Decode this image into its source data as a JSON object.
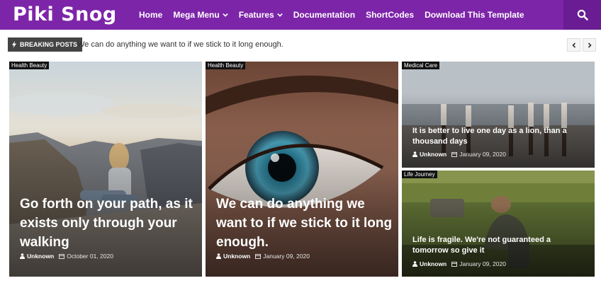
{
  "header": {
    "logo_text": "Piki Snog",
    "nav": [
      {
        "label": "Home",
        "has_dropdown": false
      },
      {
        "label": "Mega Menu",
        "has_dropdown": true
      },
      {
        "label": "Features",
        "has_dropdown": true
      },
      {
        "label": "Documentation",
        "has_dropdown": false
      },
      {
        "label": "ShortCodes",
        "has_dropdown": false
      },
      {
        "label": "Download This Template",
        "has_dropdown": false
      }
    ],
    "search_icon": "search-icon",
    "bg_color": "#7d25a9"
  },
  "ticker": {
    "label": "BREAKING POSTS",
    "text": "We can do anything we want to if we stick to it long enough."
  },
  "posts": [
    {
      "tag": "Health Beauty",
      "title": "Go forth on your path, as it exists only through your walking",
      "author": "Unknown",
      "date": "October 01, 2020"
    },
    {
      "tag": "Health Beauty",
      "title": "We can do anything we want to if we stick to it long enough.",
      "author": "Unknown",
      "date": "January 09, 2020"
    },
    {
      "tag": "Medical Care",
      "title": "It is better to live one day as a lion, than a thousand days",
      "author": "Unknown",
      "date": "January 09, 2020"
    },
    {
      "tag": "Life Journey",
      "title": "Life is fragile. We're not guaranteed a tomorrow so give it",
      "author": "Unknown",
      "date": "January 09, 2020"
    }
  ]
}
